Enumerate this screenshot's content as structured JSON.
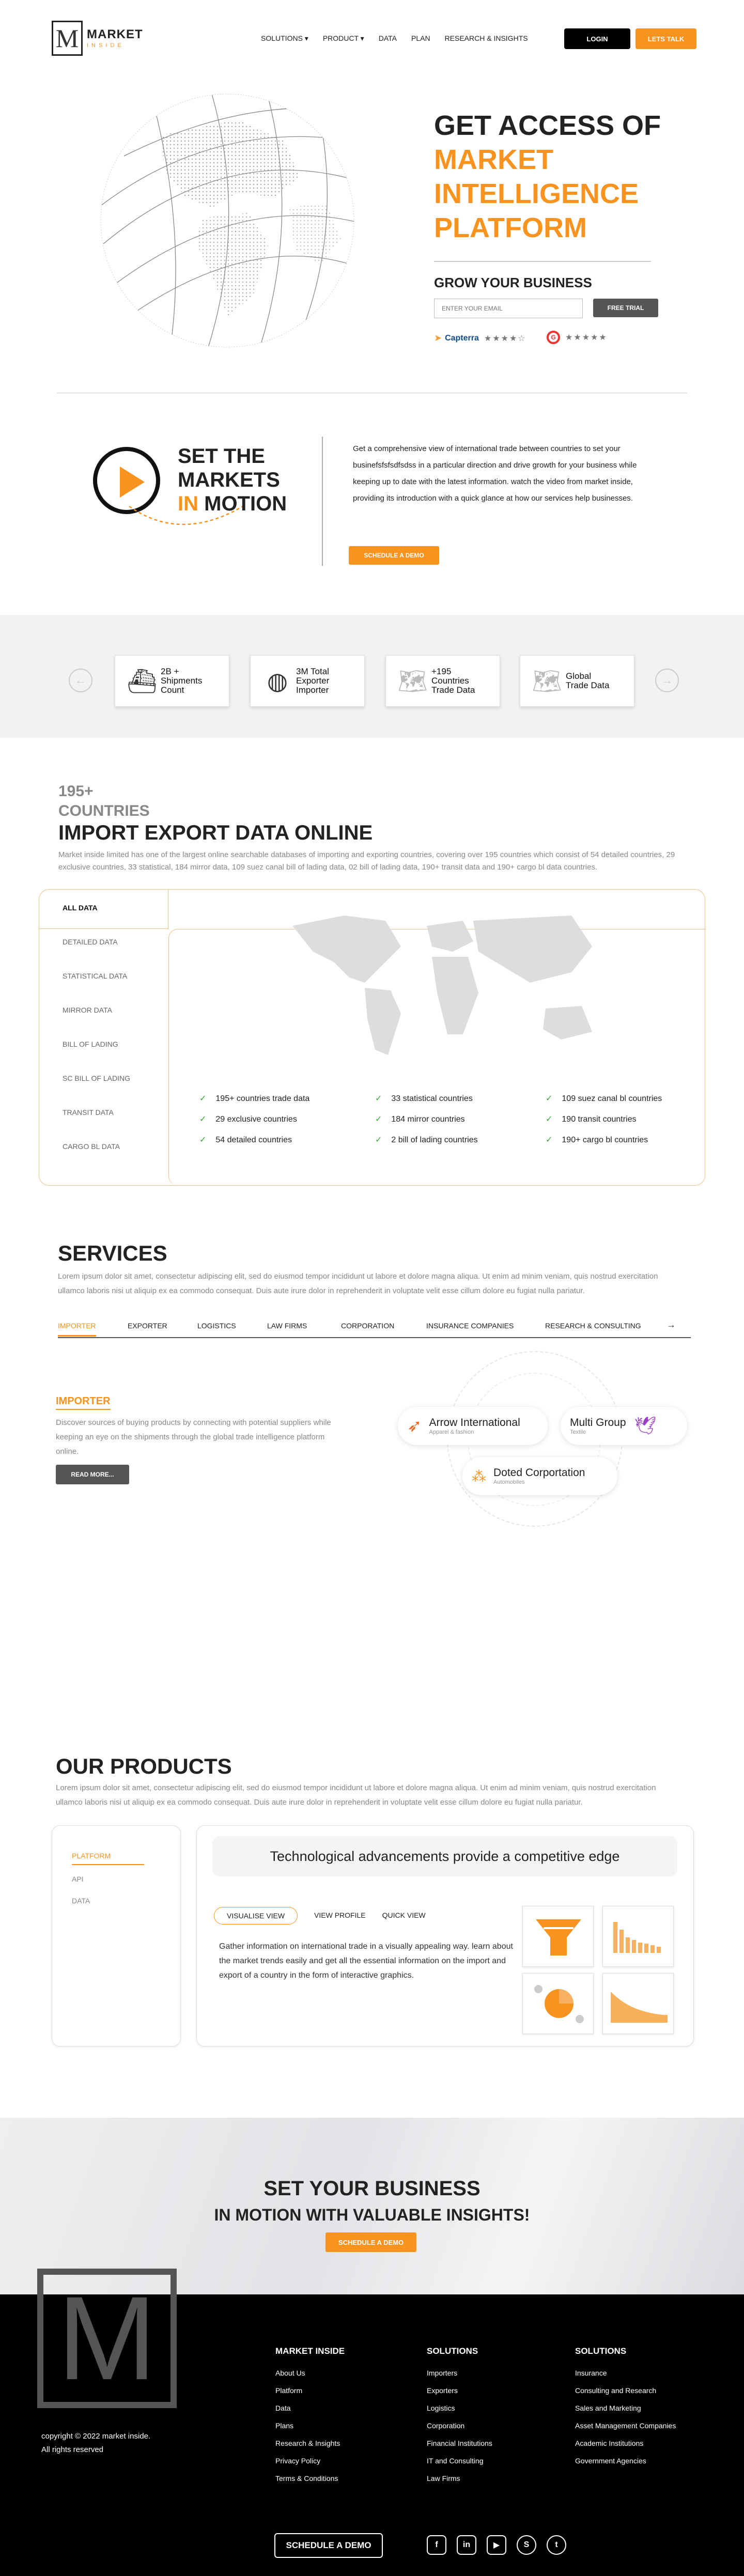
{
  "nav": {
    "logo_main": "MARKET",
    "logo_sub": "INSIDE",
    "logo_letter": "M",
    "links": [
      "SOLUTIONS ▾",
      "PRODUCT ▾",
      "DATA",
      "PLAN",
      "RESEARCH & INSIGHTS"
    ],
    "login": "LOGIN",
    "talk": "LETS TALK"
  },
  "hero": {
    "title_black": "GET ACCESS OF",
    "title_orange_1": "MARKET",
    "title_orange_2": "INTELLIGENCE",
    "title_orange_3": "PLATFORM",
    "subtitle": "GROW YOUR BUSINESS",
    "email_placeholder": "ENTER YOUR EMAIL",
    "trial": "FREE TRIAL",
    "capterra": "Capterra",
    "capterra_stars": "★★★★☆",
    "g2_stars": "★★★★★",
    "g2_badge": "G"
  },
  "motion": {
    "title_1": "SET THE",
    "title_2": "MARKETS",
    "title_3_orange": "IN",
    "title_3_black": "MOTION",
    "text": "Get a comprehensive view of international trade between countries to set your businefsfsfsdfsdss in a particular direction and drive growth for your business while keeping up to date with the latest information. watch the video from market inside, providing its introduction with a quick glance at how our services help businesses.",
    "button": "SCHEDULE A DEMO"
  },
  "stats": {
    "prev": "←",
    "next": "→",
    "cards": [
      {
        "l1": "2B +",
        "l2": "Shipments",
        "l3": "Count"
      },
      {
        "l1": "3M Total",
        "l2": "Exporter",
        "l3": "Importer"
      },
      {
        "l1": "+195",
        "l2": "Countries",
        "l3": "Trade Data"
      },
      {
        "l1": "Global",
        "l2": "Trade Data",
        "l3": ""
      }
    ]
  },
  "imex": {
    "count_1": "195+",
    "count_2": "COUNTRIES",
    "title": "IMPORT EXPORT DATA ONLINE",
    "desc": "Market inside limited has one of the largest online searchable databases of importing and exporting countries, covering over 195 countries which consist of 54 detailed countries, 29 exclusive countries, 33 statistical, 184 mirror data, 109 suez canal bill of lading data, 02 bill of lading data, 190+ transit data and 190+ cargo bl data countries.",
    "tabs": [
      "ALL DATA",
      "DETAILED DATA",
      "STATISTICAL DATA",
      "MIRROR DATA",
      "BILL OF LADING",
      "SC BILL OF LADING",
      "TRANSIT DATA",
      "CARGO BL DATA"
    ],
    "checks": [
      "195+ countries trade data",
      "33 statistical countries",
      "109 suez canal bl countries",
      "29 exclusive countries",
      "184 mirror countries",
      "190 transit countries",
      "54 detailed countries",
      "2 bill of lading countries",
      "190+ cargo bl countries"
    ]
  },
  "services": {
    "title": "SERVICES",
    "desc": "Lorem ipsum dolor sit amet, consectetur adipiscing elit, sed do eiusmod tempor incididunt ut labore et dolore magna aliqua. Ut enim ad minim veniam, quis nostrud exercitation ullamco laboris nisi ut aliquip ex ea commodo consequat. Duis aute irure dolor in reprehenderit in voluptate velit esse cillum dolore eu fugiat nulla pariatur.",
    "tabs": [
      "IMPORTER",
      "EXPORTER",
      "LOGISTICS",
      "LAW FIRMS",
      "CORPORATION",
      "INSURANCE COMPANIES",
      "RESEARCH & CONSULTING"
    ],
    "tab_arrow": "→",
    "name": "IMPORTER",
    "text": "Discover sources of buying products by connecting with potential suppliers while keeping an eye on the shipments through the global trade intelligence platform online.",
    "button": "READ MORE...",
    "companies": [
      {
        "name": "Arrow International",
        "sub": "Apparel & fashion"
      },
      {
        "name": "Multi Group",
        "sub": "Textile"
      },
      {
        "name": "Doted Corportation",
        "sub": "Automobiles"
      }
    ]
  },
  "products": {
    "title": "OUR PRODUCTS",
    "desc": "Lorem ipsum dolor sit amet, consectetur adipiscing elit, sed do eiusmod tempor incididunt ut labore et dolore magna aliqua. Ut enim ad minim veniam, quis nostrud exercitation ullamco laboris nisi ut aliquip ex ea commodo consequat. Duis aute irure dolor in reprehenderit in voluptate velit esse cillum dolore eu fugiat nulla pariatur.",
    "menu": [
      "PLATFORM",
      "API",
      "DATA"
    ],
    "heading": "Technological advancements provide a competitive edge",
    "views": [
      "VISUALISE VIEW",
      "VIEW PROFILE",
      "QUICK VIEW"
    ],
    "text": "Gather information on international trade in a visually appealing way. learn about the market trends easily and get all the essential information on the import and export of a country in the form of interactive graphics."
  },
  "cta": {
    "line1": "SET YOUR BUSINESS",
    "line2": "IN MOTION WITH VALUABLE INSIGHTS!",
    "button": "SCHEDULE A DEMO"
  },
  "footer": {
    "big_letter": "M",
    "copy1": "copyright © 2022 market inside.",
    "copy2": "All rights reserved",
    "col1_title": "MARKET INSIDE",
    "col1": [
      "About Us",
      "Platform",
      "Data",
      "Plans",
      "Research & Insights",
      "Privacy Policy",
      "Terms & Conditions"
    ],
    "col2_title": "SOLUTIONS",
    "col2": [
      "Importers",
      "Exporters",
      "Logistics",
      "Corporation",
      "Financial Institutions",
      "IT and Consulting",
      "Law Firms"
    ],
    "col3_title": "SOLUTIONS",
    "col3": [
      "Insurance",
      "Consulting and Research",
      "Sales and Marketing",
      "Asset Management Companies",
      "Academic Institutions",
      "Government Agencies"
    ],
    "button": "SCHEDULE A DEMO",
    "social": [
      "f",
      "in",
      "▶",
      "S",
      "t"
    ]
  },
  "colors": {
    "accent": "#f7931e",
    "dark": "#000000",
    "muted": "#888888"
  }
}
